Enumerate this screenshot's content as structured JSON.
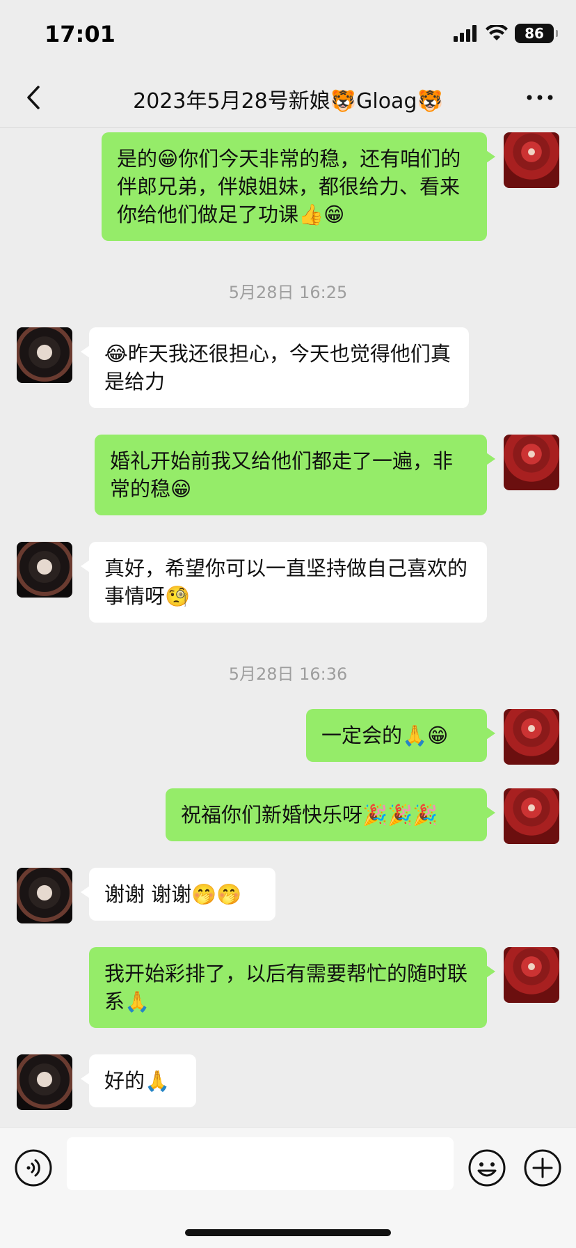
{
  "status_bar": {
    "time": "17:01",
    "battery": "86"
  },
  "header": {
    "title": "2023年5月28号新娘🐯Gloag🐯",
    "back_icon": "chevron-left-icon",
    "more_icon": "more-dots-icon"
  },
  "messages": [
    {
      "sender": "self",
      "text": "是的😁你们今天非常的稳，还有咱们的伴郎兄弟，伴娘姐妹，都很给力、看来你给他们做足了功课👍😁"
    },
    {
      "type": "timestamp",
      "text": "5月28日 16:25"
    },
    {
      "sender": "other",
      "text": "😂昨天我还很担心，今天也觉得他们真是给力"
    },
    {
      "sender": "self",
      "text": "婚礼开始前我又给他们都走了一遍，非常的稳😁"
    },
    {
      "sender": "other",
      "text": "真好，希望你可以一直坚持做自己喜欢的事情呀🧐"
    },
    {
      "type": "timestamp",
      "text": "5月28日 16:36"
    },
    {
      "sender": "self",
      "text": "一定会的🙏😁"
    },
    {
      "sender": "self",
      "text": "祝福你们新婚快乐呀🎉🎉🎉"
    },
    {
      "sender": "other",
      "text": "谢谢 谢谢🤭🤭"
    },
    {
      "sender": "self",
      "text": "我开始彩排了，以后有需要帮忙的随时联系🙏"
    },
    {
      "sender": "other",
      "text": "好的🙏"
    }
  ],
  "input_bar": {
    "placeholder": "",
    "voice_icon": "voice-icon",
    "emoji_icon": "emoji-icon",
    "plus_icon": "plus-icon"
  },
  "colors": {
    "self_bubble": "#95ec69",
    "other_bubble": "#ffffff",
    "background": "#ededed",
    "timestamp": "#9e9e9e"
  }
}
